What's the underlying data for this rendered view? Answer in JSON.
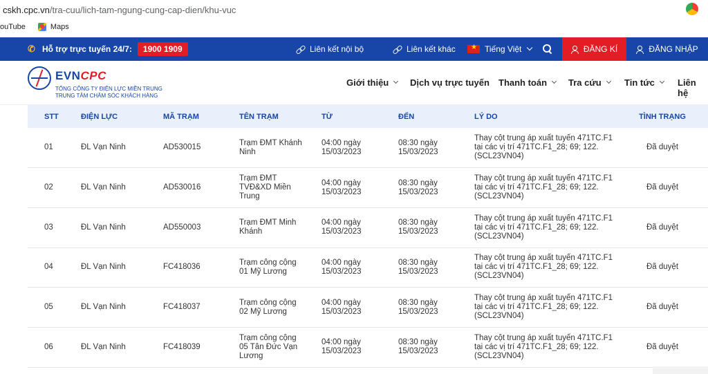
{
  "browser": {
    "url_host": "cskh.cpc.vn",
    "url_path": "/tra-cuu/lich-tam-ngung-cung-cap-dien/khu-vuc",
    "bookmarks": [
      "ouTube",
      "Maps"
    ]
  },
  "topbar": {
    "hotline_label": "Hỗ trợ trực tuyến 24/7:",
    "hotline_number": "1900 1909",
    "link_internal": "Liên kết nội bộ",
    "link_external": "Liên kết khác",
    "language": "Tiếng Việt",
    "register_label": "ĐĂNG KÍ",
    "login_label": "ĐĂNG NHẬP",
    "colors": {
      "primary": "#1745a8",
      "accent": "#e31d25"
    }
  },
  "header": {
    "logo_evn": "EVN",
    "logo_cpc": "CPC",
    "logo_sub1": "TỔNG CÔNG TY ĐIỆN LỰC MIỀN TRUNG",
    "logo_sub2": "TRUNG TÂM CHĂM SÓC KHÁCH HÀNG",
    "nav": {
      "intro": "Giới thiệu",
      "online_services": "Dịch vụ trực tuyến",
      "payment": "Thanh toán",
      "lookup": "Tra cứu",
      "news": "Tin tức",
      "contact": "Liên hệ"
    }
  },
  "table": {
    "headers": {
      "stt": "STT",
      "dien_luc": "ĐIỆN LỰC",
      "ma_tram": "MÃ TRẠM",
      "ten_tram": "TÊN TRẠM",
      "tu": "TỪ",
      "den": "ĐẾN",
      "ly_do": "LÝ DO",
      "tinh_trang": "TÌNH TRẠNG"
    },
    "rows": [
      {
        "stt": "01",
        "dien_luc": "ĐL Vạn Ninh",
        "ma_tram": "AD530015",
        "ten_tram": "Trạm ĐMT Khánh Ninh",
        "tu": "04:00 ngày 15/03/2023",
        "den": "08:30 ngày 15/03/2023",
        "ly_do": "Thay cột trung áp xuất tuyến 471TC.F1 tại các vị trí 471TC.F1_28; 69; 122. (SCL23VN04)",
        "tinh_trang": "Đã duyệt"
      },
      {
        "stt": "02",
        "dien_luc": "ĐL Vạn Ninh",
        "ma_tram": "AD530016",
        "ten_tram": "Trạm ĐMT TVĐ&XD Miền Trung",
        "tu": "04:00 ngày 15/03/2023",
        "den": "08:30 ngày 15/03/2023",
        "ly_do": "Thay cột trung áp xuất tuyến 471TC.F1 tại các vị trí 471TC.F1_28; 69; 122. (SCL23VN04)",
        "tinh_trang": "Đã duyệt"
      },
      {
        "stt": "03",
        "dien_luc": "ĐL Vạn Ninh",
        "ma_tram": "AD550003",
        "ten_tram": "Trạm ĐMT Minh Khánh",
        "tu": "04:00 ngày 15/03/2023",
        "den": "08:30 ngày 15/03/2023",
        "ly_do": "Thay cột trung áp xuất tuyến 471TC.F1 tại các vị trí 471TC.F1_28; 69; 122. (SCL23VN04)",
        "tinh_trang": "Đã duyệt"
      },
      {
        "stt": "04",
        "dien_luc": "ĐL Vạn Ninh",
        "ma_tram": "FC418036",
        "ten_tram": "Trạm công cộng 01 Mỹ Lương",
        "tu": "04:00 ngày 15/03/2023",
        "den": "08:30 ngày 15/03/2023",
        "ly_do": "Thay cột trung áp xuất tuyến 471TC.F1 tại các vị trí 471TC.F1_28; 69; 122. (SCL23VN04)",
        "tinh_trang": "Đã duyệt"
      },
      {
        "stt": "05",
        "dien_luc": "ĐL Vạn Ninh",
        "ma_tram": "FC418037",
        "ten_tram": "Trạm công cộng 02 Mỹ Lương",
        "tu": "04:00 ngày 15/03/2023",
        "den": "08:30 ngày 15/03/2023",
        "ly_do": "Thay cột trung áp xuất tuyến 471TC.F1 tại các vị trí 471TC.F1_28; 69; 122. (SCL23VN04)",
        "tinh_trang": "Đã duyệt"
      },
      {
        "stt": "06",
        "dien_luc": "ĐL Vạn Ninh",
        "ma_tram": "FC418039",
        "ten_tram": "Trạm công cộng 05 Tân Đức Vạn Lương",
        "tu": "04:00 ngày 15/03/2023",
        "den": "08:30 ngày 15/03/2023",
        "ly_do": "Thay cột trung áp xuất tuyến 471TC.F1 tại các vị trí 471TC.F1_28; 69; 122. (SCL23VN04)",
        "tinh_trang": "Đã duyệt"
      }
    ]
  }
}
